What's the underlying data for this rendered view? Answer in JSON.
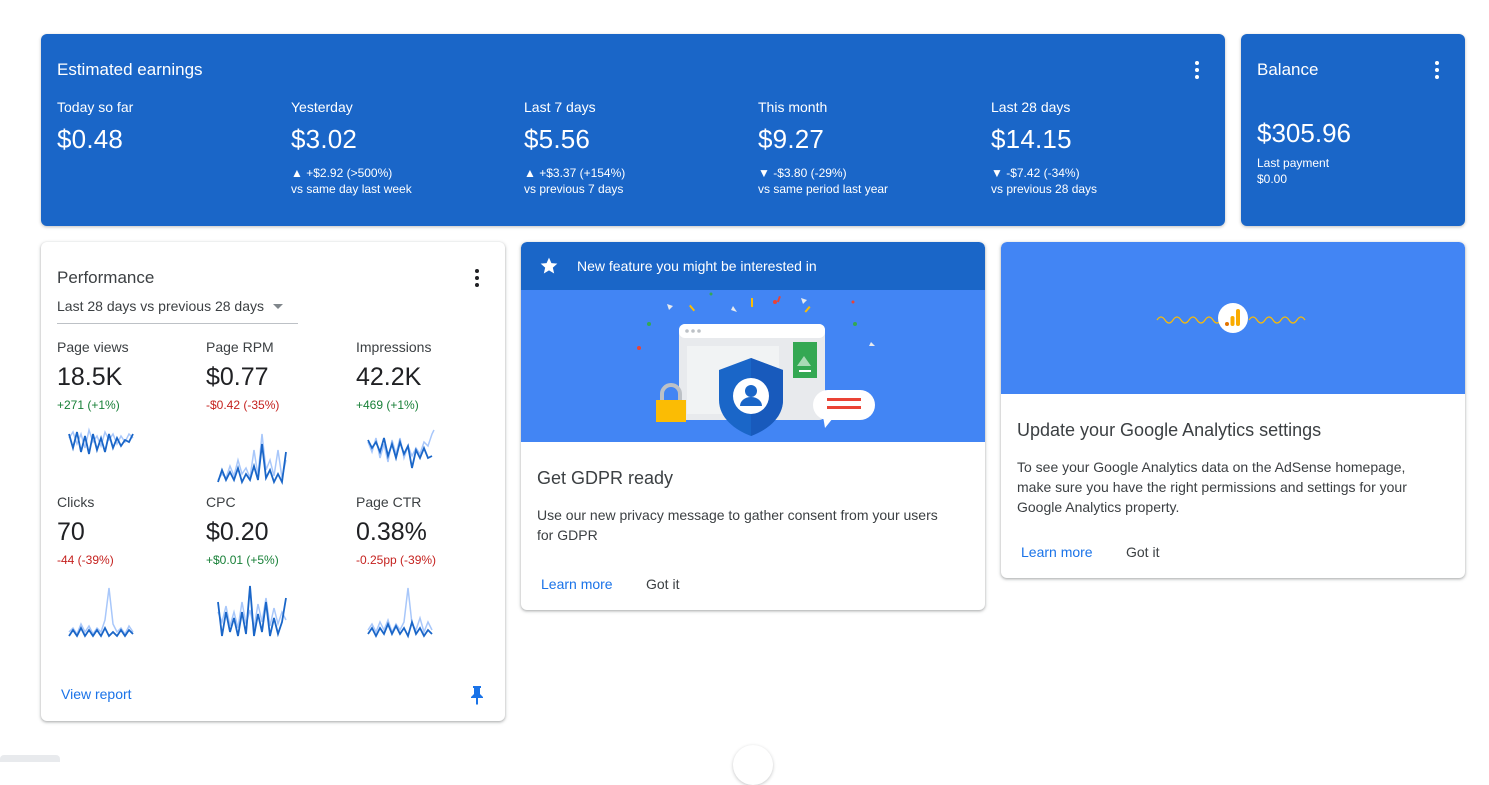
{
  "earnings": {
    "title": "Estimated earnings",
    "columns": [
      {
        "label": "Today so far",
        "value": "$0.48",
        "delta": "",
        "sub": ""
      },
      {
        "label": "Yesterday",
        "value": "$3.02",
        "delta": "▲ +$2.92 (>500%)",
        "sub": "vs same day last week"
      },
      {
        "label": "Last 7 days",
        "value": "$5.56",
        "delta": "▲ +$3.37 (+154%)",
        "sub": "vs previous 7 days"
      },
      {
        "label": "This month",
        "value": "$9.27",
        "delta": "▼ -$3.80 (-29%)",
        "sub": "vs same period last year"
      },
      {
        "label": "Last 28 days",
        "value": "$14.15",
        "delta": "▼ -$7.42 (-34%)",
        "sub": "vs previous 28 days"
      }
    ]
  },
  "balance": {
    "title": "Balance",
    "value": "$305.96",
    "last_payment_label": "Last payment",
    "last_payment_value": "$0.00"
  },
  "performance": {
    "title": "Performance",
    "range": "Last 28 days vs previous 28 days",
    "metrics": [
      {
        "label": "Page views",
        "value": "18.5K",
        "delta": "+271 (+1%)",
        "trend": "pos"
      },
      {
        "label": "Page RPM",
        "value": "$0.77",
        "delta": "-$0.42 (-35%)",
        "trend": "neg"
      },
      {
        "label": "Impressions",
        "value": "42.2K",
        "delta": "+469 (+1%)",
        "trend": "pos"
      },
      {
        "label": "Clicks",
        "value": "70",
        "delta": "-44 (-39%)",
        "trend": "neg"
      },
      {
        "label": "CPC",
        "value": "$0.20",
        "delta": "+$0.01 (+5%)",
        "trend": "pos"
      },
      {
        "label": "Page CTR",
        "value": "0.38%",
        "delta": "-0.25pp (-39%)",
        "trend": "neg"
      }
    ],
    "view_report": "View report"
  },
  "feature": {
    "header": "New feature you might be interested in",
    "heading": "Get GDPR ready",
    "body": "Use our new privacy message to gather consent from your users for GDPR",
    "learn_more": "Learn more",
    "got_it": "Got it"
  },
  "analytics": {
    "heading": "Update your Google Analytics settings",
    "body": "To see your Google Analytics data on the AdSense homepage, make sure you have the right permissions and settings for your Google Analytics property.",
    "learn_more": "Learn more",
    "got_it": "Got it"
  },
  "colors": {
    "header_blue": "#1a66c8",
    "banner_blue": "#4285f4",
    "link_blue": "#1a73e8",
    "positive": "#188038",
    "negative": "#c5221f"
  }
}
